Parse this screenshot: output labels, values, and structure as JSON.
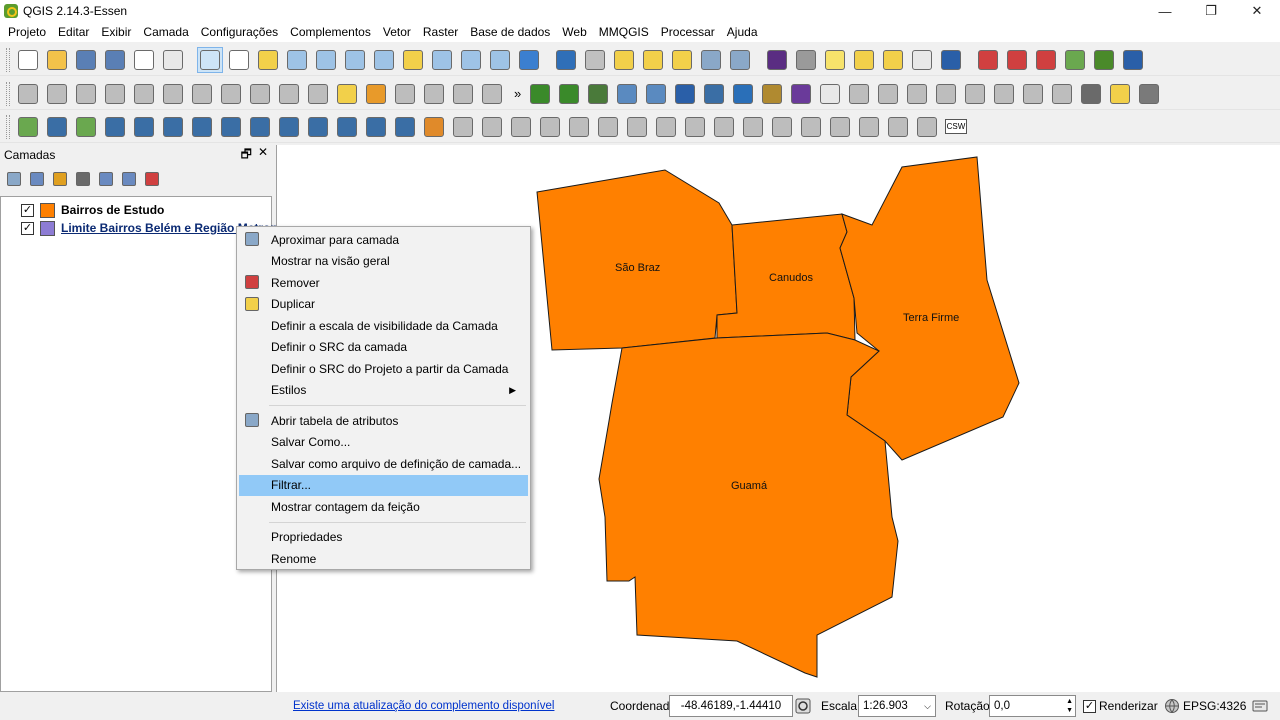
{
  "window": {
    "title": "QGIS 2.14.3-Essen",
    "controls": {
      "minimize": "—",
      "restore": "❐",
      "close": "✕"
    }
  },
  "menubar": {
    "items": [
      "Projeto",
      "Editar",
      "Exibir",
      "Camada",
      "Configurações",
      "Complementos",
      "Vetor",
      "Raster",
      "Base de dados",
      "Web",
      "MMQGIS",
      "Processar",
      "Ajuda"
    ]
  },
  "toolbars": {
    "more_glyph": "»",
    "row1": [
      {
        "name": "new-project-icon",
        "color": "#ffffff"
      },
      {
        "name": "open-project-icon",
        "color": "#f3c24a"
      },
      {
        "name": "save-project-icon",
        "color": "#5a7fb5"
      },
      {
        "name": "save-as-icon",
        "color": "#5a7fb5"
      },
      {
        "name": "new-print-composer-icon",
        "color": "#ffffff"
      },
      {
        "name": "composer-manager-icon",
        "color": "#e8e8e8"
      },
      {
        "name": "pan-touch-icon",
        "color": "#cde4f7",
        "selected": true
      },
      {
        "name": "pan-hand-icon",
        "color": "#ffffff"
      },
      {
        "name": "pan-to-selection-icon",
        "color": "#f2d04a"
      },
      {
        "name": "zoom-in-icon",
        "color": "#9ec3e6"
      },
      {
        "name": "zoom-out-icon",
        "color": "#9ec3e6"
      },
      {
        "name": "zoom-actual-icon",
        "color": "#9ec3e6"
      },
      {
        "name": "zoom-full-icon",
        "color": "#9ec3e6"
      },
      {
        "name": "zoom-to-selection-icon",
        "color": "#f2d04a"
      },
      {
        "name": "zoom-to-layer-icon",
        "color": "#9ec3e6"
      },
      {
        "name": "zoom-last-icon",
        "color": "#9ec3e6"
      },
      {
        "name": "zoom-next-icon",
        "color": "#9ec3e6"
      },
      {
        "name": "refresh-icon",
        "color": "#3b7fd0"
      },
      {
        "name": "identify-icon",
        "color": "#2f6fb8"
      },
      {
        "name": "run-feature-action-icon",
        "color": "#c0c0c0"
      },
      {
        "name": "select-features-icon",
        "color": "#f2d04a"
      },
      {
        "name": "select-by-expression-icon",
        "color": "#f2d04a"
      },
      {
        "name": "deselect-all-icon",
        "color": "#f2d04a"
      },
      {
        "name": "attribute-table-icon",
        "color": "#8aa8c8"
      },
      {
        "name": "field-calculator-icon",
        "color": "#8aa8c8"
      },
      {
        "name": "statistics-sigma-icon",
        "color": "#5a2d82"
      },
      {
        "name": "measure-line-icon",
        "color": "#9a9a9a"
      },
      {
        "name": "map-tips-icon",
        "color": "#f7e36b"
      },
      {
        "name": "new-bookmark-icon",
        "color": "#f2d04a"
      },
      {
        "name": "show-bookmarks-icon",
        "color": "#f2d04a"
      },
      {
        "name": "text-annotation-icon",
        "color": "#e8e8e8"
      },
      {
        "name": "help-icon",
        "color": "#2a5fa8"
      },
      {
        "name": "add-point-icon",
        "color": "#d04040"
      },
      {
        "name": "node-tool-icon",
        "color": "#d04040"
      },
      {
        "name": "vector-edit-icon",
        "color": "#d04040"
      },
      {
        "name": "georeference-icon",
        "color": "#6aa84f"
      },
      {
        "name": "grass-icon",
        "color": "#4a8a2a"
      },
      {
        "name": "map-swipe-icon",
        "color": "#2a5fa8"
      }
    ],
    "row2": [
      {
        "name": "current-edits-icon",
        "color": "#bdbdbd"
      },
      {
        "name": "toggle-editing-icon",
        "color": "#bdbdbd"
      },
      {
        "name": "save-layer-edits-icon",
        "color": "#bdbdbd"
      },
      {
        "name": "add-feature-icon",
        "color": "#bdbdbd"
      },
      {
        "name": "node-tool-gray-icon",
        "color": "#bdbdbd"
      },
      {
        "name": "move-feature-icon",
        "color": "#bdbdbd"
      },
      {
        "name": "delete-selected-icon",
        "color": "#bdbdbd"
      },
      {
        "name": "cut-features-icon",
        "color": "#bdbdbd"
      },
      {
        "name": "copy-features-icon",
        "color": "#bdbdbd"
      },
      {
        "name": "paste-features-icon",
        "color": "#bdbdbd"
      },
      {
        "name": "label-pin-icon",
        "color": "#bdbdbd"
      },
      {
        "name": "label-abc-icon",
        "color": "#f2d04a"
      },
      {
        "name": "label-highlight-icon",
        "color": "#e89a2a"
      },
      {
        "name": "label-pin-gray-icon",
        "color": "#bdbdbd"
      },
      {
        "name": "label-show-hide-icon",
        "color": "#bdbdbd"
      },
      {
        "name": "label-move-icon",
        "color": "#bdbdbd"
      },
      {
        "name": "label-rotate-icon",
        "color": "#bdbdbd"
      },
      {
        "name": "add-wms-icon",
        "color": "#3a8a2a"
      },
      {
        "name": "add-wfs-icon",
        "color": "#3a8a2a"
      },
      {
        "name": "add-wcs-icon",
        "color": "#4a7a3a"
      },
      {
        "name": "add-spatialite-icon",
        "color": "#5a8ac0"
      },
      {
        "name": "add-postgis-icon",
        "color": "#5a8ac0"
      },
      {
        "name": "db-manager-icon",
        "color": "#2a5fa8"
      },
      {
        "name": "python-console-icon",
        "color": "#3a6ea5"
      },
      {
        "name": "ac-icon",
        "color": "#2a6fb8"
      },
      {
        "name": "geo-tool-icon",
        "color": "#b08a30"
      },
      {
        "name": "coordinate-capture-icon",
        "color": "#6a3a9a"
      },
      {
        "name": "xy-to-point-icon",
        "color": "#e8e8e8"
      },
      {
        "name": "digitize-gray-1-icon",
        "color": "#bdbdbd"
      },
      {
        "name": "digitize-gray-2-icon",
        "color": "#bdbdbd"
      },
      {
        "name": "digitize-gray-3-icon",
        "color": "#bdbdbd"
      },
      {
        "name": "digitize-gray-4-icon",
        "color": "#bdbdbd"
      },
      {
        "name": "digitize-gray-5-icon",
        "color": "#bdbdbd"
      },
      {
        "name": "digitize-gray-6-icon",
        "color": "#bdbdbd"
      },
      {
        "name": "digitize-gray-7-icon",
        "color": "#bdbdbd"
      },
      {
        "name": "digitize-gray-8-icon",
        "color": "#bdbdbd"
      },
      {
        "name": "grid-icon",
        "color": "#6a6a6a"
      },
      {
        "name": "light-icon",
        "color": "#f2d04a"
      },
      {
        "name": "rendering-icon",
        "color": "#7a7a7a"
      }
    ],
    "row3": [
      {
        "name": "new-shapefile-icon",
        "color": "#6aa84f"
      },
      {
        "name": "add-raster-icon",
        "color": "#3a6ea5"
      },
      {
        "name": "add-vector-icon",
        "color": "#6aa84f"
      },
      {
        "name": "add-delimited-text-icon",
        "color": "#3a6ea5"
      },
      {
        "name": "add-postgis-layer-icon",
        "color": "#3a6ea5"
      },
      {
        "name": "add-spatialite-layer-icon",
        "color": "#3a6ea5"
      },
      {
        "name": "add-mssql-icon",
        "color": "#3a6ea5"
      },
      {
        "name": "add-oracle-icon",
        "color": "#3a6ea5"
      },
      {
        "name": "add-wms-layer-icon",
        "color": "#3a6ea5"
      },
      {
        "name": "add-wcs-layer-icon",
        "color": "#3a6ea5"
      },
      {
        "name": "add-wfs-layer-icon",
        "color": "#3a6ea5"
      },
      {
        "name": "virtual-layer-icon",
        "color": "#3a6ea5"
      },
      {
        "name": "new-memory-layer-icon",
        "color": "#3a6ea5"
      },
      {
        "name": "new-gps-layer-icon",
        "color": "#3a6ea5"
      },
      {
        "name": "measure-tools-icon",
        "color": "#e08a2a"
      },
      {
        "name": "advanced-digitize-icon",
        "color": "#bdbdbd"
      },
      {
        "name": "undo-icon",
        "color": "#bdbdbd"
      },
      {
        "name": "redo-icon",
        "color": "#bdbdbd"
      },
      {
        "name": "rotate-feature-icon",
        "color": "#bdbdbd"
      },
      {
        "name": "simplify-feature-icon",
        "color": "#bdbdbd"
      },
      {
        "name": "add-ring-icon",
        "color": "#bdbdbd"
      },
      {
        "name": "add-part-icon",
        "color": "#bdbdbd"
      },
      {
        "name": "fill-ring-icon",
        "color": "#bdbdbd"
      },
      {
        "name": "delete-ring-icon",
        "color": "#bdbdbd"
      },
      {
        "name": "delete-part-icon",
        "color": "#bdbdbd"
      },
      {
        "name": "reshape-icon",
        "color": "#bdbdbd"
      },
      {
        "name": "offset-curve-icon",
        "color": "#bdbdbd"
      },
      {
        "name": "split-features-icon",
        "color": "#bdbdbd"
      },
      {
        "name": "split-parts-icon",
        "color": "#bdbdbd"
      },
      {
        "name": "merge-features-icon",
        "color": "#bdbdbd"
      },
      {
        "name": "merge-attributes-icon",
        "color": "#bdbdbd"
      },
      {
        "name": "rotate-point-icon",
        "color": "#bdbdbd"
      },
      {
        "name": "csw-icon",
        "color": "#ffffff"
      }
    ],
    "csw_text": "CSW"
  },
  "layers_panel": {
    "title": "Camadas",
    "undock_glyph": "🗗",
    "close_glyph": "✕",
    "check_glyph": "✓",
    "tools": [
      {
        "name": "add-group-icon",
        "color": "#8aa8c8"
      },
      {
        "name": "manage-visibility-icon",
        "color": "#6a8ac0"
      },
      {
        "name": "filter-legend-icon",
        "color": "#e0a020"
      },
      {
        "name": "filter-by-expression-icon",
        "color": "#6a6a6a"
      },
      {
        "name": "expand-all-icon",
        "color": "#6a8ac0"
      },
      {
        "name": "collapse-all-icon",
        "color": "#6a8ac0"
      },
      {
        "name": "remove-layer-icon",
        "color": "#d04040"
      }
    ],
    "layers": [
      {
        "name": "Bairros de Estudo",
        "color": "#ff8000",
        "checked": true
      },
      {
        "name": "Limite Bairros Belém e Região Metropol",
        "color": "#8d7cd4",
        "checked": true,
        "selected": true
      }
    ]
  },
  "context_menu": {
    "items": [
      {
        "label": "Aproximar para camada",
        "icon": "zoom-to-layer-icon",
        "color": "#8aa8c8"
      },
      {
        "label": "Mostrar na visão geral"
      },
      {
        "label": "Remover",
        "icon": "remove-layer-icon",
        "color": "#d04040"
      },
      {
        "label": "Duplicar",
        "icon": "duplicate-layer-icon",
        "color": "#f2d04a"
      },
      {
        "label": "Definir a escala de visibilidade da Camada"
      },
      {
        "label": "Definir o SRC da camada"
      },
      {
        "label": "Definir o SRC do Projeto a partir da Camada"
      },
      {
        "label": "Estilos",
        "submenu": true
      },
      {
        "separator": true
      },
      {
        "label": "Abrir tabela de atributos",
        "icon": "attribute-table-icon",
        "color": "#8aa8c8"
      },
      {
        "label": "Salvar Como..."
      },
      {
        "label": "Salvar como arquivo de definição de camada..."
      },
      {
        "label": "Filtrar...",
        "highlighted": true
      },
      {
        "label": "Mostrar contagem da feição"
      },
      {
        "separator": true
      },
      {
        "label": "Propriedades"
      },
      {
        "label": "Renome"
      }
    ],
    "submenu_glyph": "▶"
  },
  "map": {
    "fill_color": "#ff8000",
    "stroke_color": "#1a1a1a",
    "labels": [
      "São Braz",
      "Canudos",
      "Terra Firme",
      "Guamá"
    ]
  },
  "statusbar": {
    "update_link": "Existe uma atualização do complemento disponível",
    "coordinate_label": "Coordenada",
    "coordinate_value": "-48.46189,-1.44410",
    "scale_label": "Escala",
    "scale_value": "1:26.903",
    "rotation_label": "Rotação",
    "rotation_value": "0,0",
    "render_label": "Renderizar",
    "render_checked": true,
    "crs_label": "EPSG:4326"
  }
}
